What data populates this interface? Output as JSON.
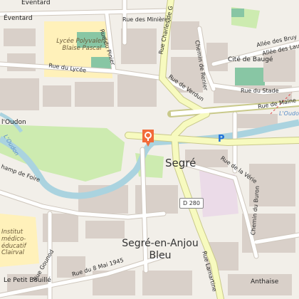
{
  "map": {
    "labels": {
      "eventard_top": "Éventard",
      "eventard": "Éventard",
      "rue_des_minieres": "Rue des Minières",
      "rue_charles_de_gaulle": "Rue Charles de G",
      "lycee": "Lycée Polyvalent Blaise Pascal",
      "rue_du_pinier": "Rue du Pinier",
      "allee_bruyeres": "Allée des Bruy",
      "allee_lauriers": "Allée des Laur",
      "cite_de_bauge": "Cité de Baugé",
      "chemin_de_renier": "Chemin de Renier",
      "rue_du_lycee": "Rue du Lycée",
      "rue_du_stade": "Rue du Stade",
      "rue_de_verdun": "Rue de Verdun",
      "rue_de_maine": "Rue de Maine",
      "l_oudon_right": "L'Oudon",
      "oudon_left": "l'Oudon",
      "l_oudon_left": "L'Oudon",
      "rue_de_la_rive": "Rue de la",
      "segre": "Segré",
      "rue_de_la_gare": "Rue de la Vérie",
      "champ_de_foire": "hamp de Foire",
      "d280": "D 280",
      "institut": "Institut médico-éducatif Clairval",
      "rue_gounod": "Rue Gounod",
      "segre_en_anjou": "Segré-en-Anjou Bleu",
      "rue_lamartine": "Rue Lamartine",
      "chemin_burons": "Chemin du Buron",
      "rue_8_mai": "Rue du 8 Mai 1945",
      "petit_bouille": "Le Petit Bouillé",
      "anthaise": "Anthaise",
      "parking": "P"
    },
    "colors": {
      "background": "#f2efe9",
      "building": "#d9d0c9",
      "primary_road": "#f7fabf",
      "primary_border": "#c9c98a",
      "road": "#ffffff",
      "road_border": "#cfc7bd",
      "water": "#aad3df",
      "park": "#cdebb0",
      "school": "#fff1ba",
      "pitch": "#88c6a4",
      "industrial": "#ebdbe8",
      "marker": "#f26b3a"
    },
    "icons": [
      "map-marker-icon",
      "parking-icon"
    ]
  }
}
